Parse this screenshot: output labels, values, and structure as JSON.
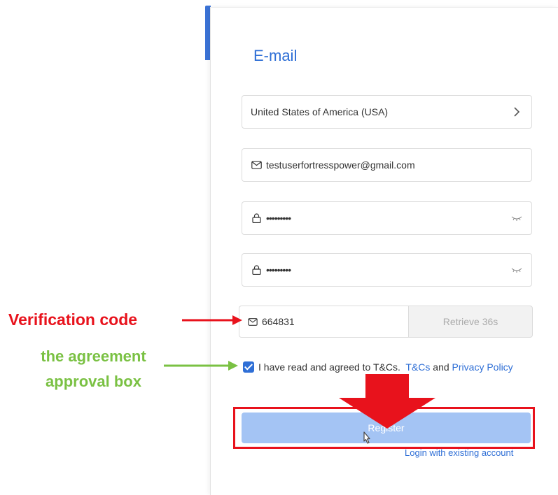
{
  "form": {
    "title": "E-mail",
    "country": {
      "value": "United States of America (USA)"
    },
    "email": {
      "value": "testuserfortresspower@gmail.com"
    },
    "password": {
      "value": "•••••••••"
    },
    "confirm_password": {
      "value": "•••••••••"
    },
    "verification": {
      "value": "664831",
      "retrieve_label": "Retrieve 36s"
    },
    "agreement": {
      "checked": true,
      "text": "I have read and agreed to T&Cs.",
      "tcs_link": "T&Cs",
      "and_text": "and",
      "privacy_link": "Privacy Policy"
    },
    "register_label": "Register",
    "login_link": "Login with existing account"
  },
  "annotations": {
    "verification_label": "Verification code",
    "agreement_label": "the agreement approval box"
  },
  "colors": {
    "accent": "#2f6fd6",
    "register_disabled": "#a4c4f4",
    "annotation_red": "#e8121c",
    "annotation_green": "#7ac143"
  }
}
